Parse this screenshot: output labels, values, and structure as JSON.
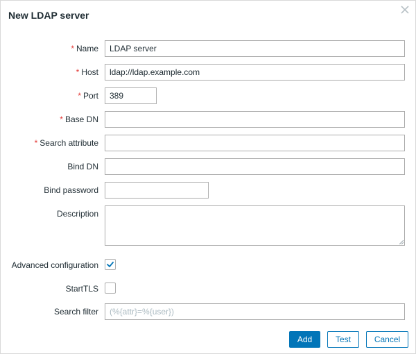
{
  "dialog": {
    "title": "New LDAP server"
  },
  "fields": {
    "name": {
      "label": "Name",
      "value": "LDAP server",
      "required": true
    },
    "host": {
      "label": "Host",
      "value": "ldap://ldap.example.com",
      "required": true
    },
    "port": {
      "label": "Port",
      "value": "389",
      "required": true
    },
    "base_dn": {
      "label": "Base DN",
      "value": "",
      "required": true
    },
    "search_attribute": {
      "label": "Search attribute",
      "value": "",
      "required": true
    },
    "bind_dn": {
      "label": "Bind DN",
      "value": ""
    },
    "bind_password": {
      "label": "Bind password",
      "value": ""
    },
    "description": {
      "label": "Description",
      "value": ""
    },
    "advanced_configuration": {
      "label": "Advanced configuration",
      "checked": true
    },
    "starttls": {
      "label": "StartTLS",
      "checked": false
    },
    "search_filter": {
      "label": "Search filter",
      "value": "",
      "placeholder": "(%{attr}=%{user})"
    }
  },
  "required_marker": "*",
  "buttons": {
    "add": "Add",
    "test": "Test",
    "cancel": "Cancel"
  },
  "icons": {
    "close": "close-icon",
    "check": "checkmark-icon",
    "resize": "resize-handle-icon"
  },
  "colors": {
    "primary": "#0275b8",
    "required": "#e33734",
    "text": "#1f2c33",
    "border": "#ababab",
    "placeholder": "#acbbc2"
  }
}
